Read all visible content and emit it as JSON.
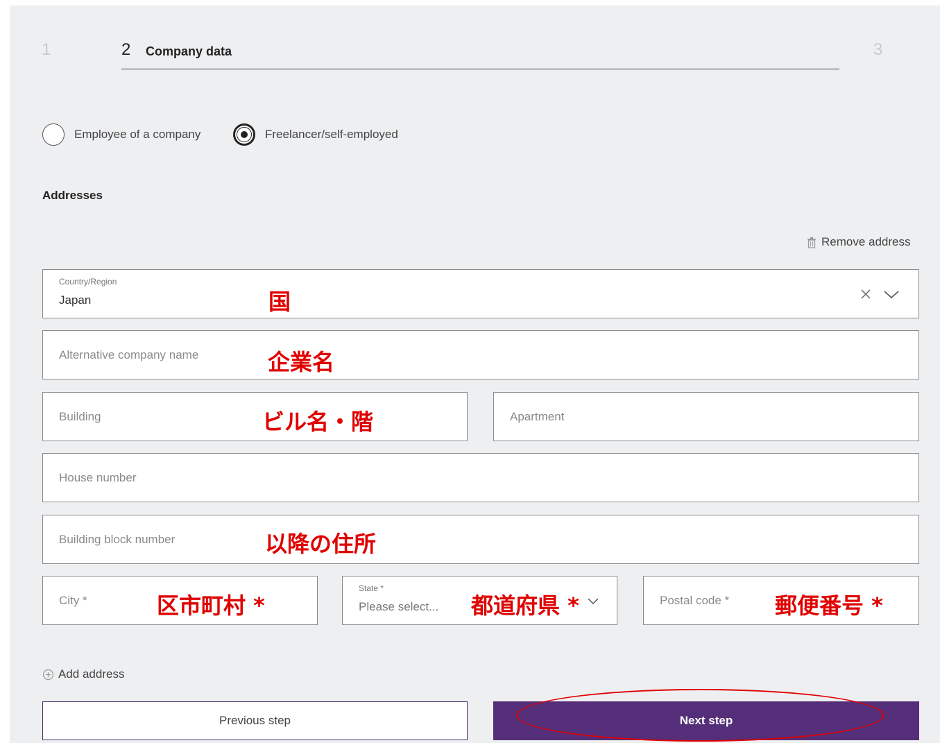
{
  "stepper": {
    "step1": "1",
    "step2_num": "2",
    "step2_label": "Company data",
    "step3": "3"
  },
  "employment": {
    "options": [
      {
        "label": "Employee of a company",
        "selected": false
      },
      {
        "label": "Freelancer/self-employed",
        "selected": true
      }
    ]
  },
  "addresses": {
    "title": "Addresses",
    "remove_label": "Remove address",
    "add_label": "Add address"
  },
  "fields": {
    "country": {
      "label": "Country/Region",
      "value": "Japan"
    },
    "alt_company": {
      "placeholder": "Alternative company name"
    },
    "building": {
      "placeholder": "Building"
    },
    "apartment": {
      "placeholder": "Apartment"
    },
    "house_number": {
      "placeholder": "House number"
    },
    "block_number": {
      "placeholder": "Building block number"
    },
    "city": {
      "placeholder": "City *"
    },
    "state": {
      "label": "State *",
      "placeholder": "Please select..."
    },
    "postal": {
      "placeholder": "Postal code *"
    }
  },
  "annotations": {
    "country": "国",
    "company": "企業名",
    "building": "ビル名・階",
    "address": "以降の住所",
    "city": "区市町村 *",
    "state": "都道府県 *",
    "postal": "郵便番号 *"
  },
  "buttons": {
    "previous": "Previous step",
    "next": "Next step"
  },
  "colors": {
    "primary": "#542e78",
    "annotation": "#e00000",
    "background": "#eeeff1"
  }
}
